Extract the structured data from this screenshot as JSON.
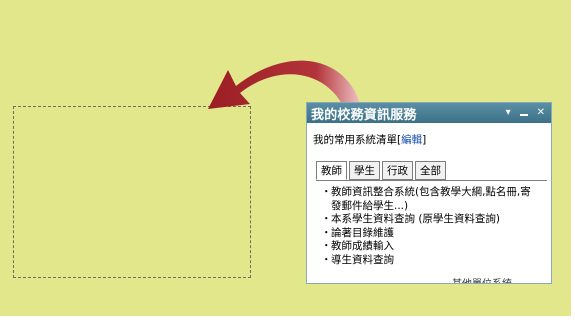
{
  "widget": {
    "title": "我的校務資訊服務",
    "controls": {
      "dropdown": "▾",
      "minimize": "–",
      "close": "✕"
    },
    "subtitle_prefix": "我的常用系統清單[",
    "edit_label": "編輯",
    "subtitle_suffix": "]",
    "tabs": [
      "教師",
      "學生",
      "行政",
      "全部"
    ],
    "active_tab": "教師",
    "bullet": "・",
    "links": [
      "教師資訊整合系統(包含教學大綱,點名冊,寄發郵件給學生...)",
      "本系學生資料查詢 (原學生資料查詢)",
      "論著目錄維護",
      "教師成績輸入",
      "導生資料查詢"
    ],
    "more_label": "其他單位系統"
  },
  "colors": {
    "background": "#e3e78c",
    "header": "#4a7f96",
    "arrow": "#a2242a"
  }
}
